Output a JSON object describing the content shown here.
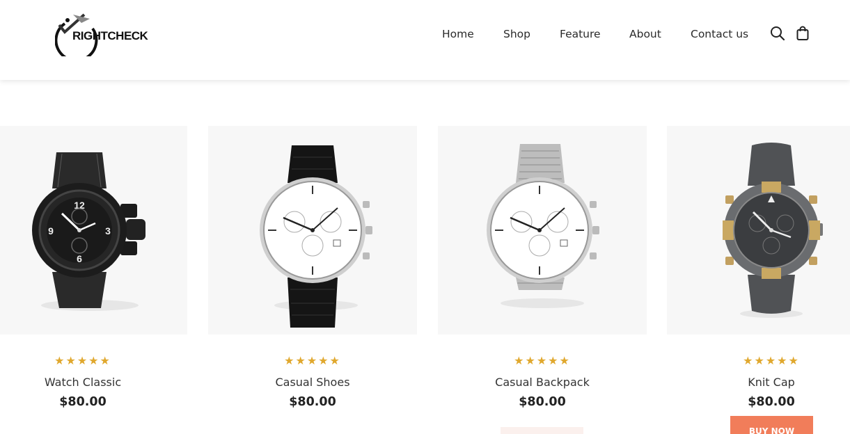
{
  "header": {
    "logo_text": "RIGHTCHECK",
    "nav": [
      {
        "label": "Home"
      },
      {
        "label": "Shop"
      },
      {
        "label": "Feature"
      },
      {
        "label": "About"
      },
      {
        "label": "Contact us"
      }
    ],
    "icons": [
      "search-icon",
      "shopping-bag-icon"
    ]
  },
  "products": [
    {
      "name": "Watch Classic",
      "price": "$80.00",
      "stars": "★★★★★",
      "rating": 5,
      "image": "black-sport-chronograph-watch"
    },
    {
      "name": "Casual Shoes",
      "price": "$80.00",
      "stars": "★★★★★",
      "rating": 5,
      "image": "white-dial-leather-strap-watch"
    },
    {
      "name": "Casual Backpack",
      "price": "$80.00",
      "stars": "★★★★★",
      "rating": 5,
      "image": "white-dial-mesh-strap-watch"
    },
    {
      "name": "Knit Cap",
      "price": "$80.00",
      "stars": "★★★★★",
      "rating": 5,
      "image": "grey-gold-pilot-chronograph-watch",
      "button": "BUY NOW"
    }
  ],
  "colors": {
    "star": "#e0a82e",
    "buy_button": "#f17d5a",
    "image_bg": "#f7f7f7"
  }
}
